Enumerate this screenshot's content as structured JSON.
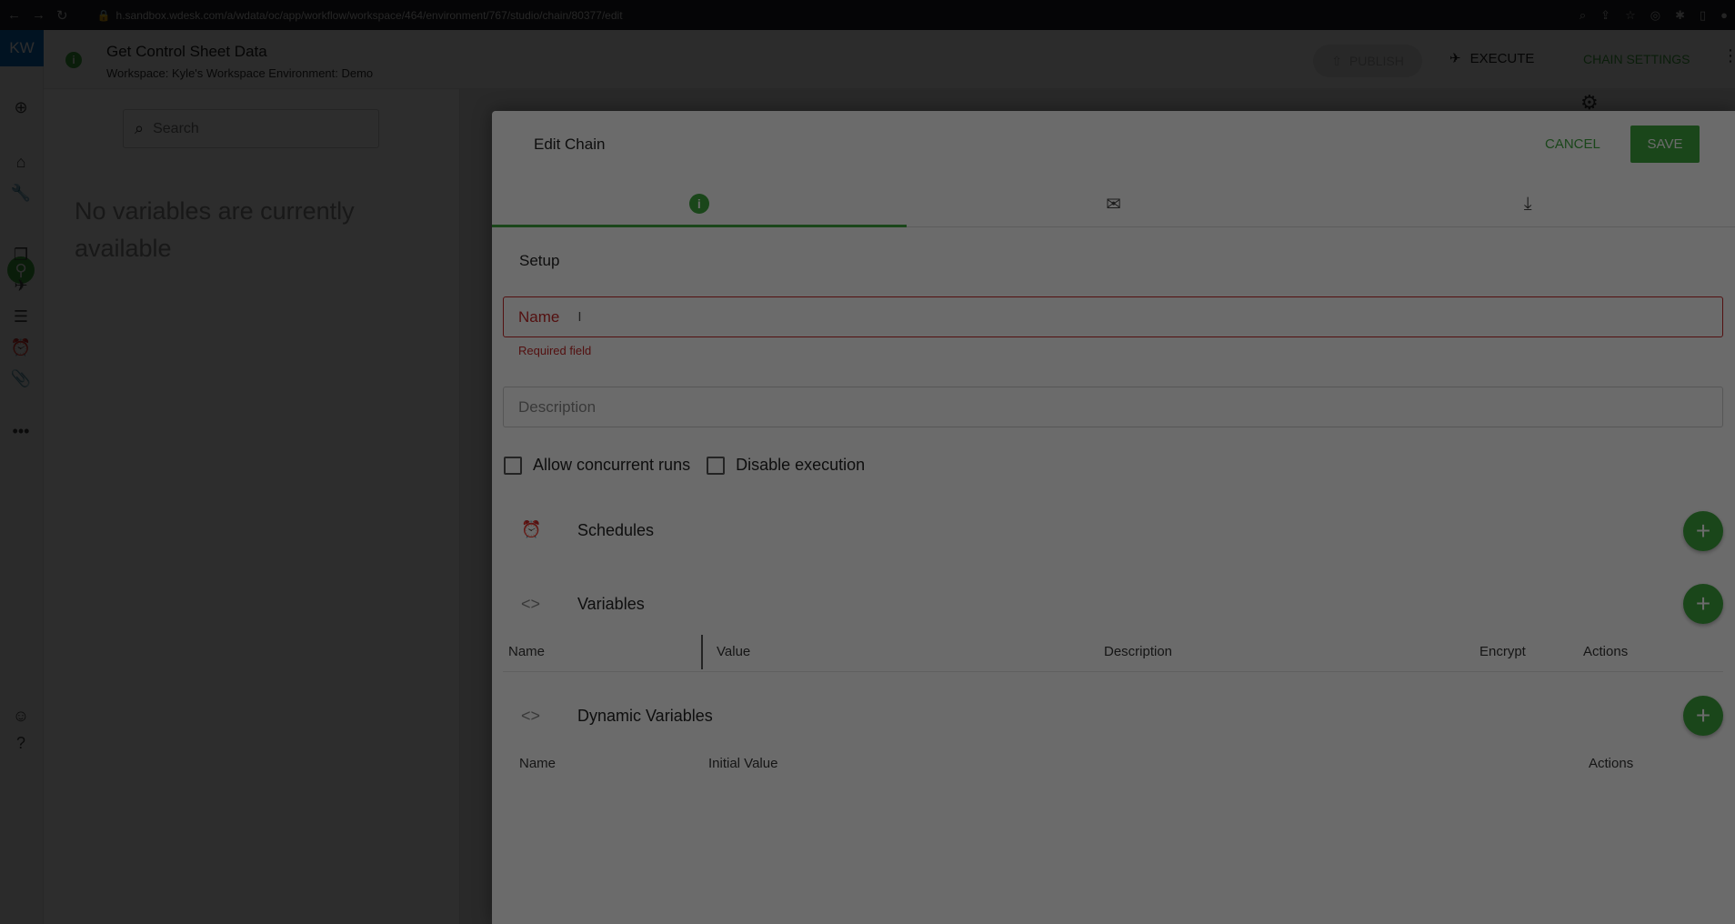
{
  "browser": {
    "url": "h.sandbox.wdesk.com/a/wdata/oc/app/workflow/workspace/464/environment/767/studio/chain/80377/edit"
  },
  "rail": {
    "logo": "KW"
  },
  "header": {
    "title": "Get Control Sheet Data",
    "subtitle": "Workspace: Kyle's Workspace Environment: Demo",
    "publish_label": "PUBLISH",
    "execute_label": "EXECUTE",
    "chain_settings_label": "CHAIN SETTINGS"
  },
  "variables_panel": {
    "search_placeholder": "Search",
    "empty_message": "No variables are currently available"
  },
  "dialog": {
    "title": "Edit Chain",
    "cancel_label": "CANCEL",
    "save_label": "SAVE",
    "tabs": [
      {
        "icon": "info-icon",
        "active": true
      },
      {
        "icon": "mail-icon",
        "active": false
      },
      {
        "icon": "download-icon",
        "active": false
      }
    ],
    "setup_label": "Setup",
    "name_placeholder": "Name",
    "name_error": "Required field",
    "description_placeholder": "Description",
    "allow_concurrent_label": "Allow concurrent runs",
    "disable_execution_label": "Disable execution",
    "schedules_label": "Schedules",
    "variables_label": "Variables",
    "variables_columns": [
      "Name",
      "Value",
      "Description",
      "Encrypt",
      "Actions"
    ],
    "dynamic_variables_label": "Dynamic Variables",
    "dynamic_columns": [
      "Name",
      "Initial Value",
      "Actions"
    ]
  },
  "colors": {
    "accent": "#3ea63e",
    "error": "#c62828",
    "logo_bg": "#0b6fc2"
  }
}
